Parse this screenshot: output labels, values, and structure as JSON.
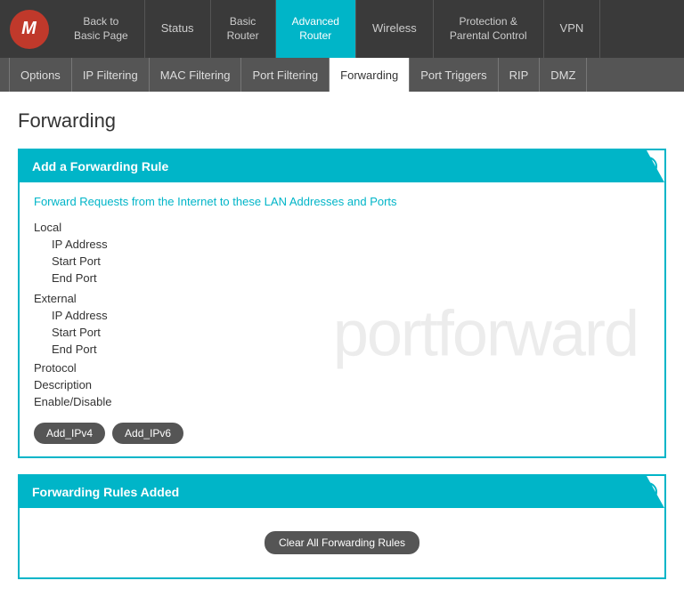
{
  "nav": {
    "logo": "M",
    "items": [
      {
        "id": "back",
        "label": "Back to\nBasic Page",
        "active": false
      },
      {
        "id": "status",
        "label": "Status",
        "active": false
      },
      {
        "id": "basic-router",
        "label": "Basic\nRouter",
        "active": false
      },
      {
        "id": "advanced-router",
        "label": "Advanced\nRouter",
        "active": true
      },
      {
        "id": "wireless",
        "label": "Wireless",
        "active": false
      },
      {
        "id": "protection",
        "label": "Protection &\nParental Control",
        "active": false
      },
      {
        "id": "vpn",
        "label": "VPN",
        "active": false
      }
    ]
  },
  "subnav": {
    "items": [
      {
        "id": "options",
        "label": "Options",
        "active": false
      },
      {
        "id": "ip-filtering",
        "label": "IP Filtering",
        "active": false
      },
      {
        "id": "mac-filtering",
        "label": "MAC Filtering",
        "active": false
      },
      {
        "id": "port-filtering",
        "label": "Port Filtering",
        "active": false
      },
      {
        "id": "forwarding",
        "label": "Forwarding",
        "active": true
      },
      {
        "id": "port-triggers",
        "label": "Port Triggers",
        "active": false
      },
      {
        "id": "rip",
        "label": "RIP",
        "active": false
      },
      {
        "id": "dmz",
        "label": "DMZ",
        "active": false
      }
    ]
  },
  "page": {
    "title": "Forwarding"
  },
  "add_rule_section": {
    "header": "Add a Forwarding Rule",
    "forward_link": "Forward Requests from the Internet to these LAN Addresses and Ports",
    "watermark": "portforward",
    "local_label": "Local",
    "local_fields": [
      "IP Address",
      "Start Port",
      "End Port"
    ],
    "external_label": "External",
    "external_fields": [
      "IP Address",
      "Start Port",
      "End Port"
    ],
    "extra_fields": [
      "Protocol",
      "Description",
      "Enable/Disable"
    ],
    "buttons": [
      {
        "id": "add-ipv4",
        "label": "Add_IPv4"
      },
      {
        "id": "add-ipv6",
        "label": "Add_IPv6"
      }
    ]
  },
  "rules_section": {
    "header": "Forwarding Rules Added",
    "clear_button": "Clear All Forwarding Rules"
  }
}
